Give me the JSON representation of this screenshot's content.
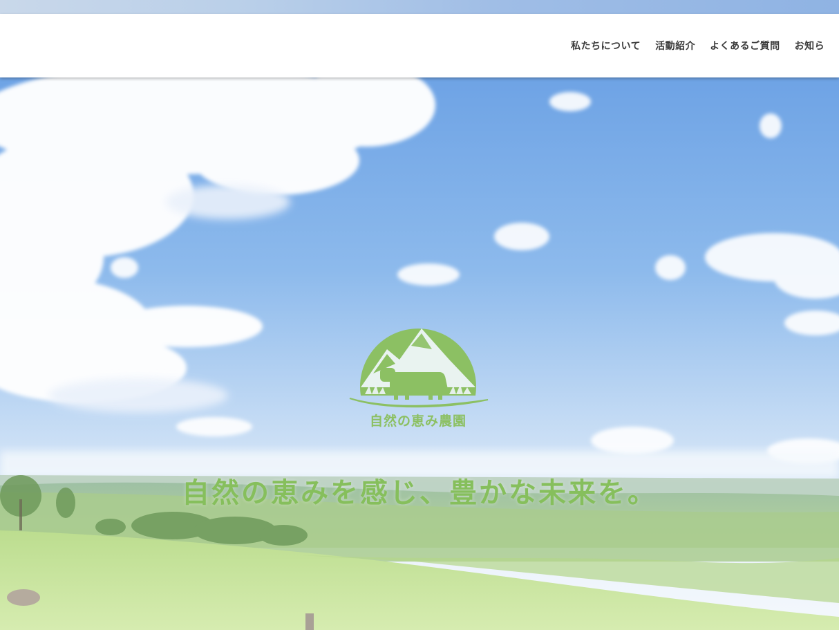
{
  "nav": {
    "items": [
      {
        "label": "私たちについて"
      },
      {
        "label": "活動紹介"
      },
      {
        "label": "よくあるご質問"
      },
      {
        "label": "お知ら"
      }
    ]
  },
  "hero": {
    "logo_icon": "mountain-cow-logo-icon",
    "logo_text": "自然の恵み農園",
    "tagline": "自然の恵みを感じ、豊かな未来を。"
  },
  "colors": {
    "brand_green": "#8cc063",
    "nav_text": "#3a3a3a",
    "sky_top": "#6fa3e6",
    "sky_bottom": "#eaf2fb",
    "grass": "#c6e39a"
  }
}
